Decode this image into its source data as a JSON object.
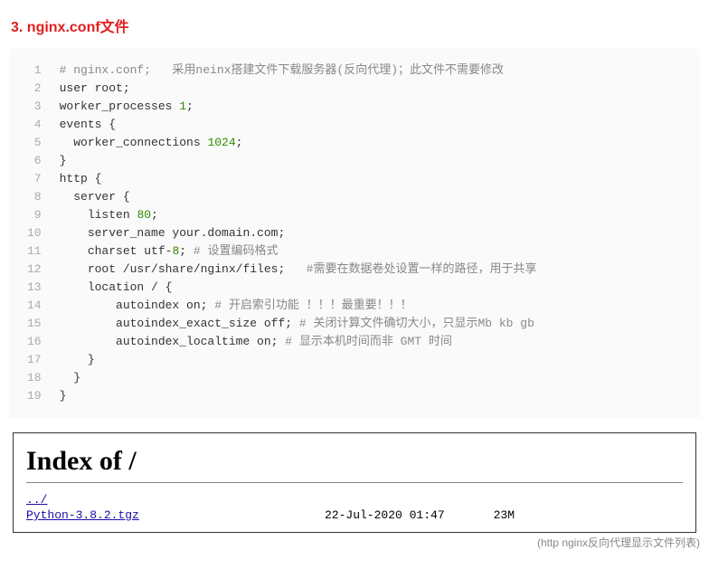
{
  "heading": "3. nginx.conf文件",
  "code": {
    "line_count": 19,
    "lines": [
      [
        [
          "# nginx.conf;   采用neinx搭建文件下载服务器(反向代理)；此文件不需要修改",
          "cmt"
        ]
      ],
      [
        [
          "user root;",
          ""
        ]
      ],
      [
        [
          "worker_processes ",
          ""
        ],
        [
          "1",
          "num"
        ],
        [
          ";",
          ""
        ]
      ],
      [
        [
          "events {",
          ""
        ]
      ],
      [
        [
          "  worker_connections ",
          ""
        ],
        [
          "1024",
          "num"
        ],
        [
          ";",
          ""
        ]
      ],
      [
        [
          "}",
          ""
        ]
      ],
      [
        [
          "http {",
          ""
        ]
      ],
      [
        [
          "  server {",
          ""
        ]
      ],
      [
        [
          "    listen ",
          ""
        ],
        [
          "80",
          "num"
        ],
        [
          ";",
          ""
        ]
      ],
      [
        [
          "    server_name your.domain.com;",
          ""
        ]
      ],
      [
        [
          "    charset utf-",
          ""
        ],
        [
          "8",
          "num"
        ],
        [
          "; ",
          ""
        ],
        [
          "# 设置编码格式",
          "cmt"
        ]
      ],
      [
        [
          "    root /usr/share/nginx/files;   ",
          ""
        ],
        [
          "#需要在数据卷处设置一样的路径，用于共享",
          "cmt"
        ]
      ],
      [
        [
          "    location / {",
          ""
        ]
      ],
      [
        [
          "        autoindex on; ",
          ""
        ],
        [
          "# 开启索引功能 ！！！最重要！！！",
          "cmt"
        ]
      ],
      [
        [
          "        autoindex_exact_size off; ",
          ""
        ],
        [
          "# 关闭计算文件确切大小，只显示Mb kb gb",
          "cmt"
        ]
      ],
      [
        [
          "        autoindex_localtime on; ",
          ""
        ],
        [
          "# 显示本机时间而非 GMT 时间",
          "cmt"
        ]
      ],
      [
        [
          "    }",
          ""
        ]
      ],
      [
        [
          "  }",
          ""
        ]
      ],
      [
        [
          "}",
          ""
        ]
      ]
    ]
  },
  "index": {
    "title": "Index of /",
    "parent": "../",
    "rows": [
      {
        "name": "Python-3.8.2.tgz",
        "date": "22-Jul-2020 01:47",
        "size": "23M"
      }
    ]
  },
  "caption": "(http nginx反向代理显示文件列表)"
}
